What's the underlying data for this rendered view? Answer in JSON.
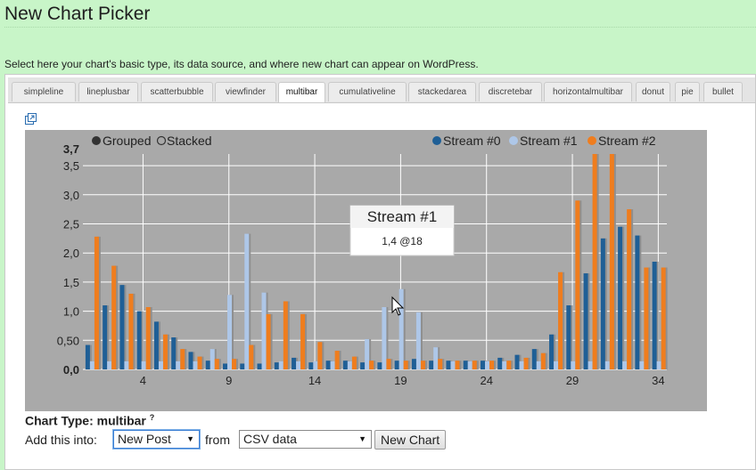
{
  "page": {
    "title": "New Chart Picker",
    "description": "Select here your chart's basic type, its data source, and where new chart can appear on WordPress."
  },
  "tabs": [
    {
      "label": "simpleline",
      "active": false
    },
    {
      "label": "lineplusbar",
      "active": false
    },
    {
      "label": "scatterbubble",
      "active": false
    },
    {
      "label": "viewfinder",
      "active": false
    },
    {
      "label": "multibar",
      "active": true
    },
    {
      "label": "cumulativeline",
      "active": false
    },
    {
      "label": "stackedarea",
      "active": false
    },
    {
      "label": "discretebar",
      "active": false
    },
    {
      "label": "horizontalmultibar",
      "active": false
    },
    {
      "label": "donut",
      "active": false
    },
    {
      "label": "pie",
      "active": false
    },
    {
      "label": "bullet",
      "active": false
    }
  ],
  "controls": {
    "grouped_label": "Grouped",
    "stacked_label": "Stacked",
    "grouped_selected": true
  },
  "tooltip": {
    "title": "Stream #1",
    "value": "1,4 @18"
  },
  "chart_type": {
    "label": "Chart Type: multibar",
    "help": "?"
  },
  "form": {
    "add_label": "Add this into:",
    "post_select": "New Post",
    "from_label": "from",
    "source_select": "CSV data",
    "button_label": "New Chart"
  },
  "colors": {
    "background": "#c8f5c8",
    "chart_bg": "#a9a9a9",
    "stream0": "#1f5f96",
    "stream1": "#aec7e8",
    "stream2": "#ef7d1e"
  },
  "chart_data": {
    "type": "bar",
    "x": [
      1,
      2,
      3,
      4,
      5,
      6,
      7,
      8,
      9,
      10,
      11,
      12,
      13,
      14,
      15,
      16,
      17,
      18,
      19,
      20,
      21,
      22,
      23,
      24,
      25,
      26,
      27,
      28,
      29,
      30,
      31,
      32,
      33,
      34
    ],
    "x_ticks": [
      4,
      9,
      14,
      19,
      24,
      29,
      34
    ],
    "y_ticks": [
      "0,0",
      "0,50",
      "1,0",
      "1,5",
      "2,0",
      "2,5",
      "3,0",
      "3,5"
    ],
    "y_max_label": "3,7",
    "ylim": [
      0,
      3.7
    ],
    "grid": true,
    "legend_position": "top-right",
    "series": [
      {
        "name": "Stream #0",
        "values": [
          0.42,
          1.1,
          1.45,
          1.0,
          0.82,
          0.55,
          0.3,
          0.15,
          0.1,
          0.1,
          0.1,
          0.12,
          0.2,
          0.12,
          0.15,
          0.15,
          0.12,
          0.12,
          0.15,
          0.18,
          0.15,
          0.15,
          0.15,
          0.15,
          0.2,
          0.25,
          0.35,
          0.6,
          1.1,
          1.65,
          2.25,
          2.45,
          2.3,
          1.85,
          1.25
        ]
      },
      {
        "name": "Stream #1",
        "values": [
          0.14,
          0.14,
          0.14,
          0.14,
          0.14,
          0.14,
          0.14,
          0.35,
          1.28,
          2.33,
          1.32,
          0.14,
          0.14,
          0.14,
          0.14,
          0.14,
          0.52,
          1.07,
          1.38,
          0.98,
          0.38,
          0.14,
          0.14,
          0.14,
          0.14,
          0.14,
          0.14,
          0.14,
          0.14,
          0.14,
          0.14,
          0.14,
          0.14,
          0.14,
          0.14
        ]
      },
      {
        "name": "Stream #2",
        "values": [
          2.28,
          1.78,
          1.3,
          1.07,
          0.6,
          0.35,
          0.22,
          0.18,
          0.18,
          0.42,
          0.95,
          1.17,
          0.95,
          0.47,
          0.32,
          0.22,
          0.15,
          0.18,
          0.15,
          0.15,
          0.18,
          0.15,
          0.15,
          0.15,
          0.15,
          0.2,
          0.28,
          1.67,
          2.9,
          3.7,
          3.7,
          2.75,
          1.75,
          1.75,
          0.97
        ]
      }
    ]
  }
}
